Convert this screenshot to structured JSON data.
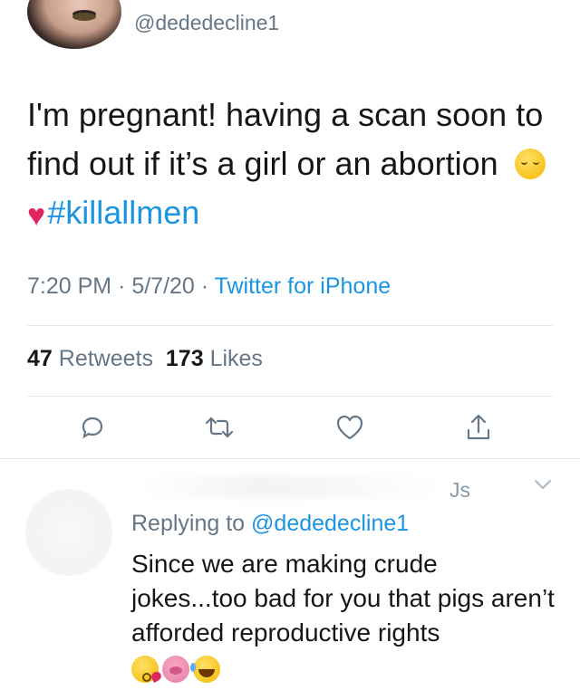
{
  "tweet": {
    "handle": "@dededecline1",
    "text_main": "I'm pregnant! having a scan soon to find out if it’s a girl or an abortion ",
    "hashtag": "#killallmen",
    "emojis": [
      "relieved-face",
      "red-heart"
    ],
    "time": "7:20 PM",
    "date": "5/7/20",
    "source": "Twitter for iPhone",
    "separator": " · ",
    "retweets_count": "47",
    "retweets_label": "Retweets",
    "likes_count": "173",
    "likes_label": "Likes"
  },
  "actions": [
    {
      "name": "reply-icon"
    },
    {
      "name": "retweet-icon"
    },
    {
      "name": "like-icon"
    },
    {
      "name": "share-icon"
    }
  ],
  "reply": {
    "name_visible_tail": "Js",
    "replying_prefix": "Replying to ",
    "replying_mention": "@dededecline1",
    "text": "Since we are making crude jokes...too bad for you that pigs aren’t afforded reproductive rights",
    "emojis": [
      "kissing-face",
      "pig-nose",
      "tears-of-joy"
    ]
  },
  "colors": {
    "link": "#1b95e0",
    "secondary": "#657786",
    "primary": "#14171a",
    "divider": "#e1e8ed"
  }
}
